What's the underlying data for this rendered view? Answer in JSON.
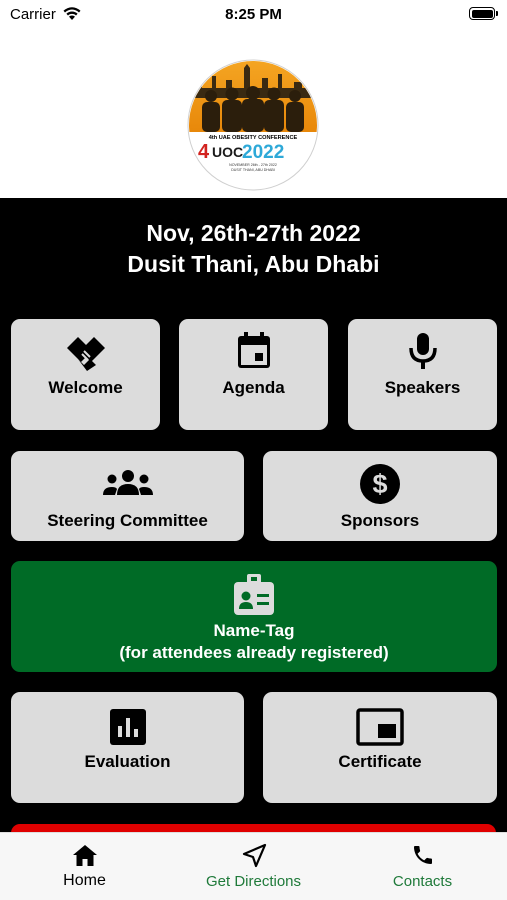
{
  "status_bar": {
    "carrier": "Carrier",
    "time": "8:25 PM"
  },
  "logo": {
    "line1": "4th UAE OBESITY CONFERENCE",
    "brand_num": "4",
    "brand_mid": "UOC",
    "brand_year": "2022",
    "small1": "NOVEMBER 26th - 27th 2022",
    "small2": "DUSIT THANI, ABU DHABI"
  },
  "event": {
    "date": "Nov, 26th-27th 2022",
    "venue": "Dusit Thani, Abu Dhabi"
  },
  "tiles": {
    "welcome": "Welcome",
    "agenda": "Agenda",
    "speakers": "Speakers",
    "steering": "Steering Committee",
    "sponsors": "Sponsors",
    "nametag": "Name-Tag",
    "nametag_sub": "(for attendees already registered)",
    "evaluation": "Evaluation",
    "certificate": "Certificate"
  },
  "nav": {
    "home": "Home",
    "directions": "Get Directions",
    "contacts": "Contacts"
  },
  "colors": {
    "tile": "#dcdcdc",
    "green": "#006b26",
    "red": "#e00000",
    "nav_green": "#1f7a3a"
  }
}
